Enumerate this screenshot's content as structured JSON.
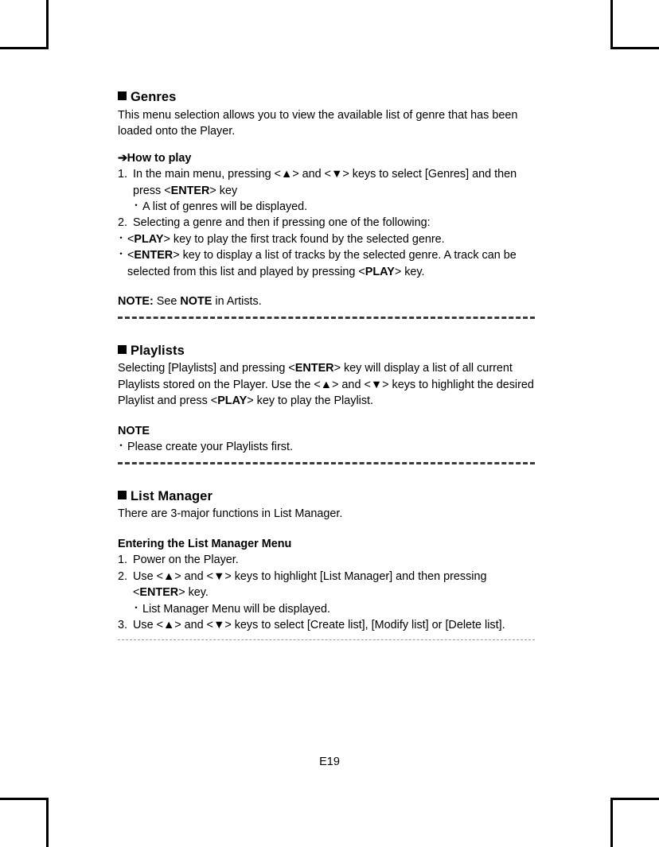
{
  "page": {
    "number_label": "E19"
  },
  "sections": [
    {
      "id": "genres",
      "heading": "Genres",
      "intro": "This menu selection allows you to view the available list of genre that has been loaded onto the Player.",
      "how_to_play_label": "How to play",
      "arrow_glyph": "➔",
      "steps": [
        {
          "num": "1.",
          "text_parts": [
            {
              "t": "In the main menu, pressing <",
              "b": false
            },
            {
              "t": "▲",
              "b": true
            },
            {
              "t": "> and <",
              "b": false
            },
            {
              "t": "▼",
              "b": true
            },
            {
              "t": "> keys to select [Genres] and then press <",
              "b": false
            },
            {
              "t": "ENTER",
              "b": true
            },
            {
              "t": "> key",
              "b": false
            }
          ],
          "sub_bullets": [
            "A list of genres will be displayed."
          ]
        },
        {
          "num": "2.",
          "text_parts": [
            {
              "t": "Selecting a genre and then if pressing one of the following:",
              "b": false
            }
          ],
          "sub_bullets": []
        }
      ],
      "deep_bullets": [
        [
          {
            "t": "<",
            "b": false
          },
          {
            "t": "PLAY",
            "b": true
          },
          {
            "t": "> key to play the first track found by the selected genre.",
            "b": false
          }
        ],
        [
          {
            "t": "<",
            "b": false
          },
          {
            "t": "ENTER",
            "b": true
          },
          {
            "t": "> key to display a list of tracks by the selected genre. A track can be selected from this list and played by pressing <",
            "b": false
          },
          {
            "t": "PLAY",
            "b": true
          },
          {
            "t": "> key.",
            "b": false
          }
        ]
      ],
      "note_line": [
        {
          "t": "NOTE:",
          "b": true
        },
        {
          "t": " See ",
          "b": false
        },
        {
          "t": "NOTE",
          "b": true
        },
        {
          "t": " in Artists.",
          "b": false
        }
      ],
      "rule_style": "bold"
    },
    {
      "id": "playlists",
      "heading": "Playlists",
      "intro_parts": [
        {
          "t": "Selecting [Playlists] and pressing <",
          "b": false
        },
        {
          "t": "ENTER",
          "b": true
        },
        {
          "t": "> key will display a list of all current Playlists stored on the Player. Use the <",
          "b": false
        },
        {
          "t": "▲",
          "b": true
        },
        {
          "t": "> and <",
          "b": false
        },
        {
          "t": "▼",
          "b": true
        },
        {
          "t": "> keys to highlight the desired Playlist and press <",
          "b": false
        },
        {
          "t": "PLAY",
          "b": true
        },
        {
          "t": "> key to play the Playlist.",
          "b": false
        }
      ],
      "note_heading": "NOTE",
      "note_bullets": [
        "Please create your Playlists first."
      ],
      "rule_style": "bold"
    },
    {
      "id": "list-manager",
      "heading": "List Manager",
      "intro": "There are 3-major functions in List Manager.",
      "sub_heading": "Entering the List Manager Menu",
      "steps": [
        {
          "num": "1.",
          "text_parts": [
            {
              "t": "Power on the Player.",
              "b": false
            }
          ],
          "sub_bullets": []
        },
        {
          "num": "2.",
          "text_parts": [
            {
              "t": "Use <",
              "b": false
            },
            {
              "t": "▲",
              "b": true
            },
            {
              "t": "> and <",
              "b": false
            },
            {
              "t": "▼",
              "b": true
            },
            {
              "t": "> keys to highlight [List Manager] and then pressing <",
              "b": false
            },
            {
              "t": "ENTER",
              "b": true
            },
            {
              "t": "> key.",
              "b": false
            }
          ],
          "sub_bullets": [
            "List Manager Menu will be displayed."
          ]
        },
        {
          "num": "3.",
          "text_parts": [
            {
              "t": "Use <",
              "b": false
            },
            {
              "t": "▲",
              "b": true
            },
            {
              "t": "> and <",
              "b": false
            },
            {
              "t": "▼",
              "b": true
            },
            {
              "t": "> keys to select [Create list], [Modify list] or [Delete list].",
              "b": false
            }
          ],
          "sub_bullets": []
        }
      ],
      "rule_style": "light"
    }
  ]
}
